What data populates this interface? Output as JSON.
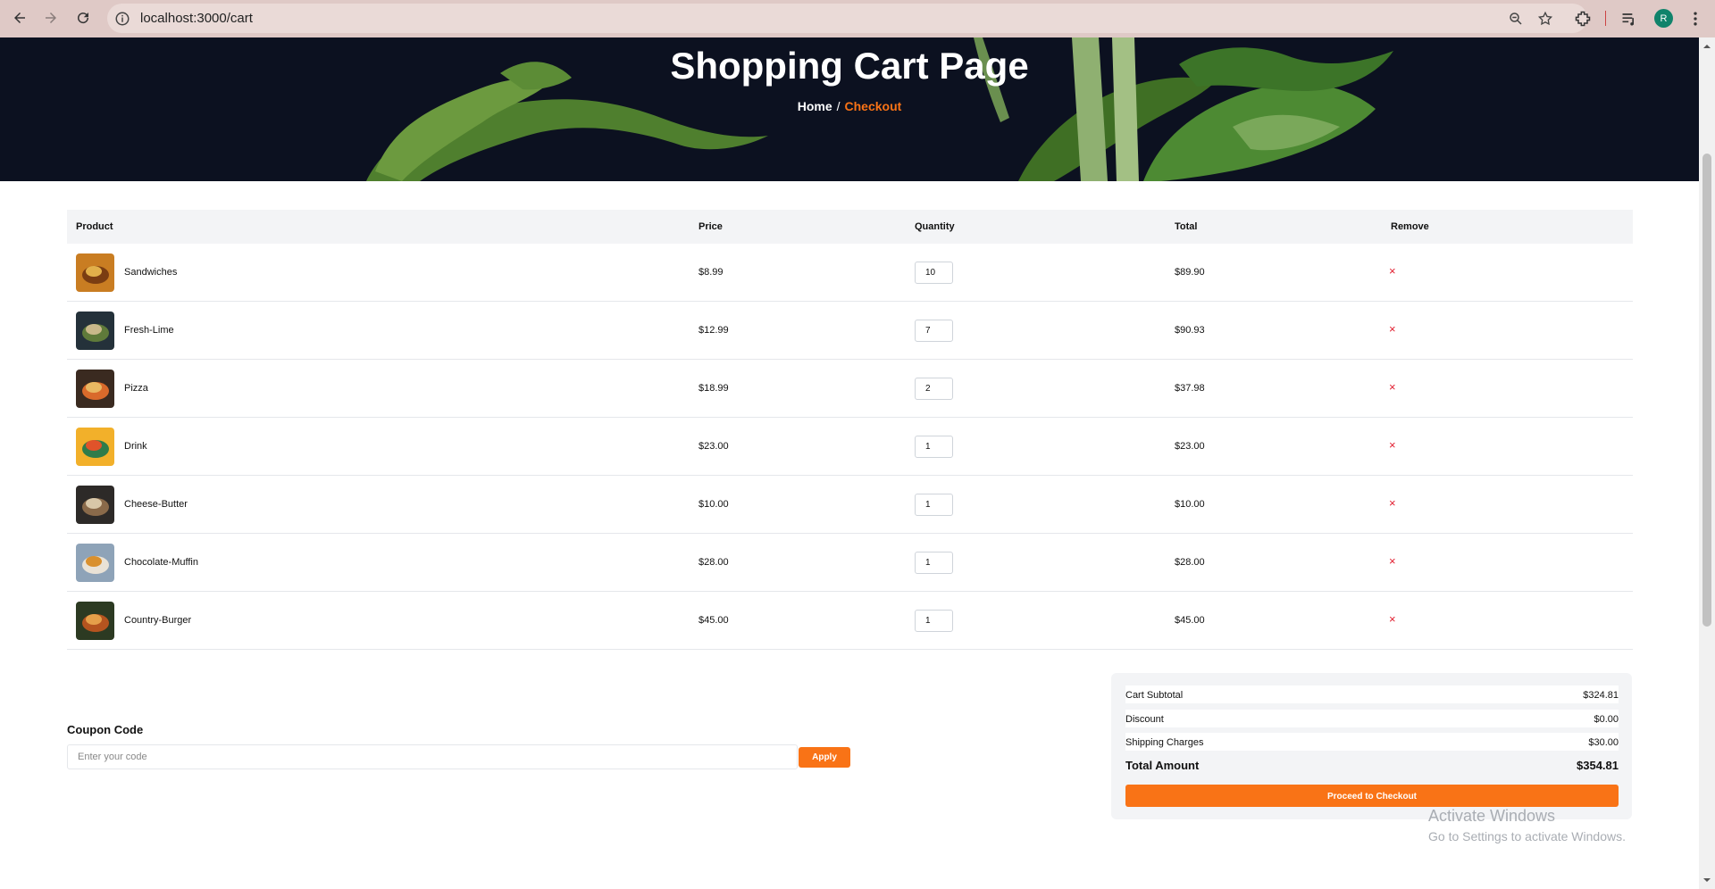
{
  "browser": {
    "url": "localhost:3000/cart",
    "avatar_initial": "R"
  },
  "hero": {
    "title": "Shopping Cart Page",
    "breadcrumb_home": "Home",
    "breadcrumb_sep": "/",
    "breadcrumb_active": "Checkout"
  },
  "table": {
    "headers": {
      "product": "Product",
      "price": "Price",
      "quantity": "Quantity",
      "total": "Total",
      "remove": "Remove"
    },
    "rows": [
      {
        "name": "Sandwiches",
        "price": "$8.99",
        "qty": "10",
        "total": "$89.90",
        "remove": "×",
        "thumb_colors": [
          "#c97d22",
          "#7a3d12",
          "#e2b04a"
        ]
      },
      {
        "name": "Fresh-Lime",
        "price": "$12.99",
        "qty": "7",
        "total": "$90.93",
        "remove": "×",
        "thumb_colors": [
          "#24313a",
          "#5f7a3a",
          "#c9b88a"
        ]
      },
      {
        "name": "Pizza",
        "price": "$18.99",
        "qty": "2",
        "total": "$37.98",
        "remove": "×",
        "thumb_colors": [
          "#3a2a20",
          "#d96a2b",
          "#e9b862"
        ]
      },
      {
        "name": "Drink",
        "price": "$23.00",
        "qty": "1",
        "total": "$23.00",
        "remove": "×",
        "thumb_colors": [
          "#f2b02a",
          "#2f7c4a",
          "#e0532a"
        ]
      },
      {
        "name": "Cheese-Butter",
        "price": "$10.00",
        "qty": "1",
        "total": "$10.00",
        "remove": "×",
        "thumb_colors": [
          "#2d2a28",
          "#8a6a4a",
          "#d8c7a8"
        ]
      },
      {
        "name": "Chocolate-Muffin",
        "price": "$28.00",
        "qty": "1",
        "total": "$28.00",
        "remove": "×",
        "thumb_colors": [
          "#8ea3b8",
          "#e9e2d6",
          "#d9902e"
        ]
      },
      {
        "name": "Country-Burger",
        "price": "$45.00",
        "qty": "1",
        "total": "$45.00",
        "remove": "×",
        "thumb_colors": [
          "#2c3a22",
          "#b5541f",
          "#e6a04a"
        ]
      }
    ]
  },
  "coupon": {
    "label": "Coupon Code",
    "placeholder": "Enter your code",
    "apply_label": "Apply"
  },
  "summary": {
    "subtotal_label": "Cart Subtotal",
    "subtotal_value": "$324.81",
    "discount_label": "Discount",
    "discount_value": "$0.00",
    "shipping_label": "Shipping Charges",
    "shipping_value": "$30.00",
    "total_label": "Total Amount",
    "total_value": "$354.81",
    "checkout_label": "Proceed to Checkout"
  },
  "watermark": {
    "line1": "Activate Windows",
    "line2": "Go to Settings to activate Windows."
  },
  "colors": {
    "accent": "#f97316",
    "remove": "#e11d2e",
    "hero_bg": "#0d1220",
    "chrome_bg": "#dfc9c6"
  }
}
